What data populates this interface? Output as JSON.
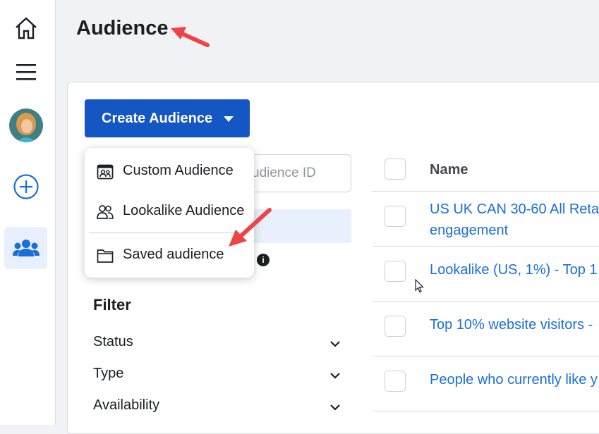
{
  "header": {
    "title": "Audience"
  },
  "sidebar": {
    "items": [
      {
        "icon": "home-icon"
      },
      {
        "icon": "menu-icon"
      },
      {
        "icon": "avatar"
      },
      {
        "icon": "plus-circle-icon"
      },
      {
        "icon": "audience-icon"
      }
    ]
  },
  "toolbar": {
    "create_label": "Create Audience"
  },
  "dropdown": {
    "items": [
      {
        "label": "Custom Audience",
        "icon": "custom-audience-icon"
      },
      {
        "label": "Lookalike Audience",
        "icon": "lookalike-icon"
      },
      {
        "label": "Saved audience",
        "icon": "folder-icon"
      }
    ]
  },
  "search": {
    "placeholder": "Search by name or audience ID",
    "visible_text": "udience ID"
  },
  "filter": {
    "title": "Filter",
    "rows": [
      "Status",
      "Type",
      "Availability"
    ]
  },
  "table": {
    "column_header": "Name",
    "rows": [
      {
        "line1": "US UK CAN 30-60 All Reta",
        "line2": "engagement"
      },
      {
        "line1": "Lookalike (US, 1%) - Top 1"
      },
      {
        "line1": "Top 10% website visitors -"
      },
      {
        "line1": "People who currently like y"
      }
    ]
  },
  "colors": {
    "accent": "#1456c4",
    "link": "#1a6ed8",
    "annotation": "#ee4444"
  }
}
